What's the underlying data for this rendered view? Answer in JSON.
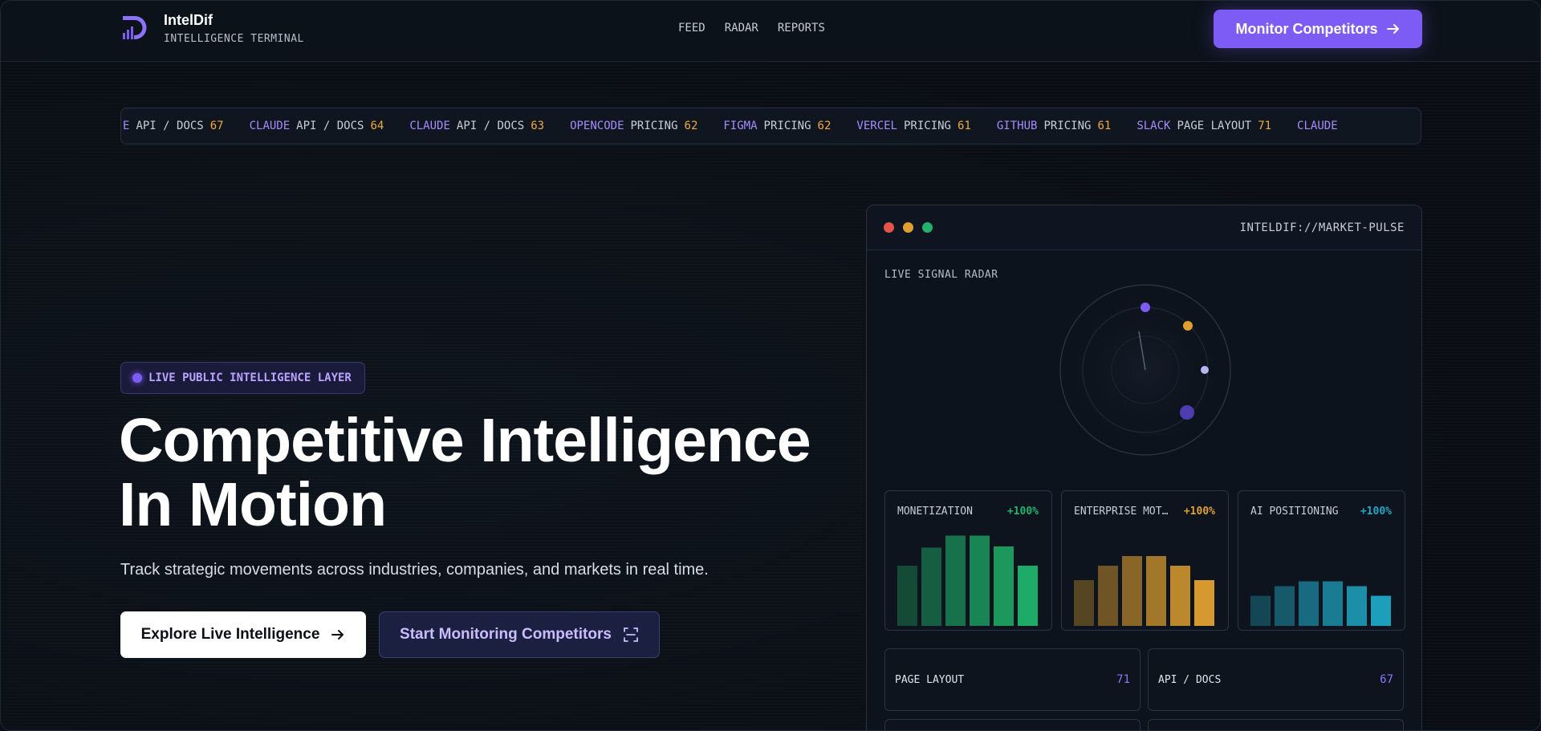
{
  "header": {
    "brand_name": "IntelDif",
    "brand_sub": "INTELLIGENCE TERMINAL",
    "nav": [
      "FEED",
      "RADAR",
      "REPORTS"
    ],
    "cta_label": "Monitor Competitors"
  },
  "ticker": {
    "items": [
      {
        "company": "E",
        "category": "API / DOCS",
        "value": "67"
      },
      {
        "company": "CLAUDE",
        "category": "API / DOCS",
        "value": "64"
      },
      {
        "company": "CLAUDE",
        "category": "API / DOCS",
        "value": "63"
      },
      {
        "company": "OPENCODE",
        "category": "PRICING",
        "value": "62"
      },
      {
        "company": "FIGMA",
        "category": "PRICING",
        "value": "62"
      },
      {
        "company": "VERCEL",
        "category": "PRICING",
        "value": "61"
      },
      {
        "company": "GITHUB",
        "category": "PRICING",
        "value": "61"
      },
      {
        "company": "SLACK",
        "category": "PAGE LAYOUT",
        "value": "71"
      },
      {
        "company": "CLAUDE",
        "category": "",
        "value": ""
      }
    ]
  },
  "hero": {
    "badge": "LIVE PUBLIC INTELLIGENCE LAYER",
    "title_line1": "Competitive Intelligence",
    "title_line2": "In Motion",
    "subtitle": "Track strategic movements across industries, companies, and markets in real time.",
    "primary_button": "Explore Live Intelligence",
    "secondary_button": "Start Monitoring Competitors"
  },
  "panel": {
    "title": "INTELDIF://MARKET-PULSE",
    "radar_label": "LIVE SIGNAL RADAR",
    "window_dots": [
      "#e5534b",
      "#e0a030",
      "#1fb36b"
    ],
    "metrics": [
      {
        "name": "MONETIZATION",
        "pct": "+100%",
        "color": "#1fb36b",
        "bars": [
          0.5,
          0.65,
          0.75,
          0.75,
          0.66,
          0.5
        ]
      },
      {
        "name": "ENTERPRISE MOT…",
        "pct": "+100%",
        "color": "#e0a030",
        "bars": [
          0.38,
          0.5,
          0.58,
          0.58,
          0.5,
          0.38
        ]
      },
      {
        "name": "AI POSITIONING",
        "pct": "+100%",
        "color": "#1fa7c4",
        "bars": [
          0.25,
          0.33,
          0.37,
          0.37,
          0.33,
          0.25
        ]
      }
    ],
    "stats": [
      {
        "name": "PAGE LAYOUT",
        "value": "71"
      },
      {
        "name": "API / DOCS",
        "value": "67"
      }
    ]
  }
}
